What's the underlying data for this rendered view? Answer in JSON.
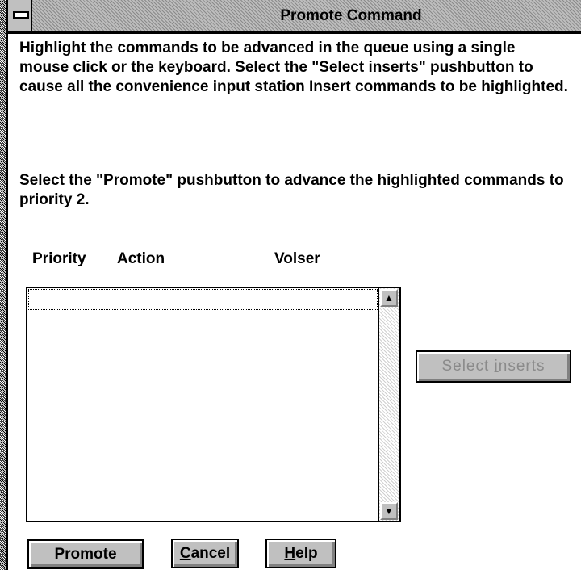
{
  "window": {
    "title": "Promote Command"
  },
  "instructions": {
    "paragraph1": "Highlight the commands to be advanced in the queue using a single mouse click or the keyboard. Select the \"Select inserts\" pushbutton to cause all the convenience input station Insert commands to be highlighted.",
    "paragraph2": "Select the \"Promote\" pushbutton to advance the highlighted commands to priority 2."
  },
  "list": {
    "columns": [
      "Priority",
      "Action",
      "Volser"
    ],
    "rows": []
  },
  "buttons": {
    "promote": {
      "mnemonic": "P",
      "rest": "romote"
    },
    "cancel": {
      "mnemonic": "C",
      "rest": "ancel"
    },
    "help": {
      "mnemonic": "H",
      "rest": "elp"
    },
    "select_inserts": {
      "prefix": "Select ",
      "mnemonic": "i",
      "rest": "nserts",
      "enabled": false
    }
  },
  "icons": {
    "system_menu": "system-menu-icon",
    "scroll_up": "scroll-up-arrow-icon",
    "scroll_down": "scroll-down-arrow-icon"
  }
}
